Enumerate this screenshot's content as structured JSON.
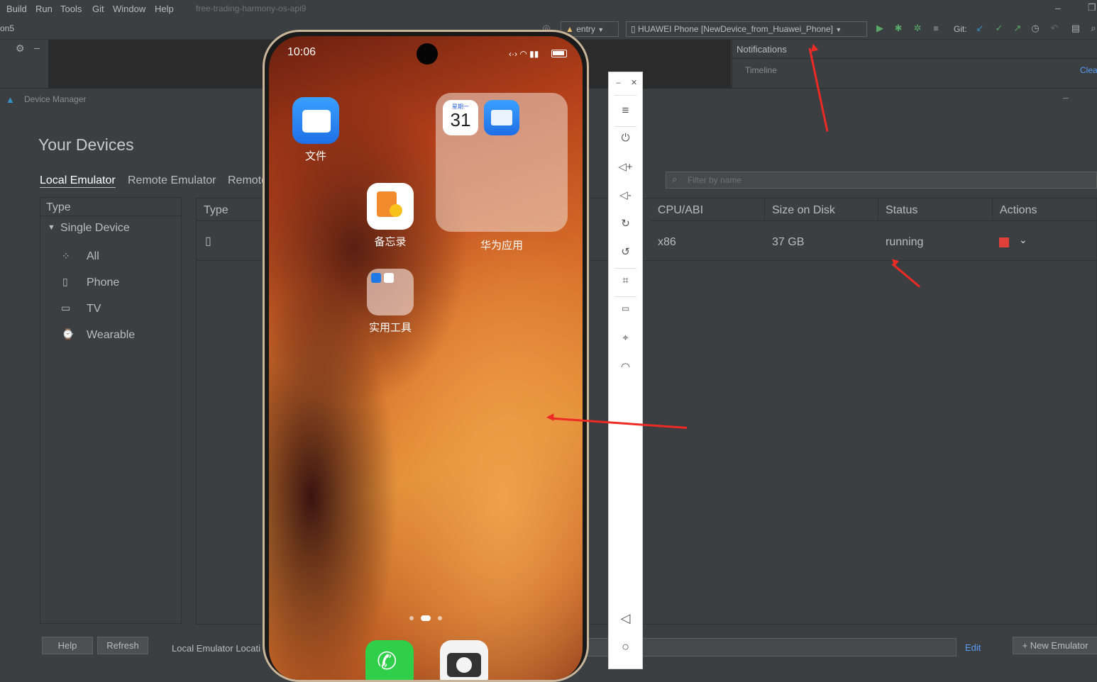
{
  "menu": {
    "items": [
      "Build",
      "Run",
      "Tools",
      "Git",
      "Window",
      "Help"
    ],
    "project": "free-trading-harmony-os-api9"
  },
  "toolbar": {
    "left_text": "on5",
    "module": "entry",
    "device": "HUAWEI Phone [NewDevice_from_Huawei_Phone]",
    "git_label": "Git:"
  },
  "notifications": {
    "title": "Notifications",
    "timeline": "Timeline",
    "clear": "Clea"
  },
  "device_manager": {
    "title": "Device Manager",
    "heading": "Your Devices",
    "tabs": [
      "Local Emulator",
      "Remote Emulator",
      "Remote"
    ],
    "filter_placeholder": "Filter by name",
    "type_panel": {
      "header": "Type",
      "group": "Single Device",
      "items": [
        "All",
        "Phone",
        "TV",
        "Wearable"
      ]
    },
    "table": {
      "headers": [
        "Type",
        "CPU/ABI",
        "Size on Disk",
        "Status",
        "Actions"
      ],
      "row": {
        "cpu": "x86",
        "size": "37 GB",
        "status": "running"
      }
    },
    "footer": {
      "help": "Help",
      "refresh": "Refresh",
      "location_label": "Local Emulator Locati",
      "edit": "Edit",
      "new_emulator": "+ New Emulator"
    },
    "colors": {
      "accent_link": "#589df6",
      "stop_red": "#e0403a",
      "annotation_red": "#ee2a24"
    }
  },
  "phone": {
    "time": "10:06",
    "apps": {
      "files": "文件",
      "memo": "备忘录",
      "huawei_apps": "华为应用",
      "tools": "实用工具",
      "calendar_day": "31",
      "calendar_weekday": "星期一"
    }
  }
}
